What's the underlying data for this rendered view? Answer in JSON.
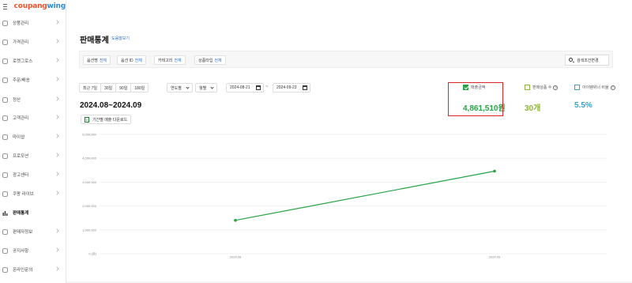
{
  "app": {
    "logo_parts": [
      "coupang",
      " ",
      "wing"
    ],
    "colors": {
      "accent": "#2a6fd0",
      "green": "#27a346",
      "olive": "#8cb43c",
      "teal": "#3aa0c8",
      "highlight": "#d8262c"
    }
  },
  "sidebar": {
    "items": [
      {
        "label": "상품관리",
        "icon": "box-icon"
      },
      {
        "label": "가격관리",
        "icon": "price-tag-icon"
      },
      {
        "label": "로켓그로스",
        "icon": "rocket-icon"
      },
      {
        "label": "주문/배송",
        "icon": "truck-icon"
      },
      {
        "label": "정산",
        "icon": "coin-icon"
      },
      {
        "label": "고객관리",
        "icon": "smile-icon"
      },
      {
        "label": "마이샵",
        "icon": "shop-icon"
      },
      {
        "label": "프로모션",
        "icon": "promotion-icon"
      },
      {
        "label": "광고센터",
        "icon": "ad-icon"
      },
      {
        "label": "쿠팡 라이브",
        "icon": "live-icon"
      },
      {
        "label": "판매통계",
        "icon": "bar-chart-icon",
        "active": true
      },
      {
        "label": "판매자정보",
        "icon": "user-icon"
      },
      {
        "label": "공지사항",
        "icon": "notice-icon"
      },
      {
        "label": "온라인문의",
        "icon": "headset-icon"
      }
    ]
  },
  "page": {
    "title": "판매통계",
    "help_link": "도움말보기"
  },
  "filters": {
    "chips": [
      {
        "label": "옵션명",
        "value": "전체"
      },
      {
        "label": "옵션 ID",
        "value": "전체"
      },
      {
        "label": "카테고리",
        "value": "전체"
      },
      {
        "label": "상품타입",
        "value": "전체"
      }
    ],
    "search_button": "검색조건변경"
  },
  "range": {
    "presets": [
      "최근 7일",
      "30일",
      "90일",
      "180일"
    ],
    "unit_select": "연도별",
    "month_select": "월별",
    "start_date": "2024-08-21",
    "end_date": "2024-09-23",
    "separator": "~"
  },
  "period_label": "2024.08~2024.09",
  "download_button": "기간별 매출 다운로드",
  "metrics": [
    {
      "label": "매출금액",
      "value": "4,861,510원",
      "checked": true,
      "color": "#27a346"
    },
    {
      "label": "판매상품 수",
      "value": "30개",
      "checked": false,
      "color": "#8cb43c"
    },
    {
      "label": "아이템위너 비율",
      "value": "5.5%",
      "checked": false,
      "color": "#3aa0c8"
    }
  ],
  "chart_data": {
    "type": "line",
    "title": "",
    "xlabel": "",
    "ylabel": "",
    "categories": [
      "2024.08",
      "2024.09"
    ],
    "series": [
      {
        "values": [
          1400000,
          3460000
        ],
        "color": "#27a346"
      }
    ],
    "yticks": [
      "0 (원)",
      "1,000,000",
      "2,000,000",
      "3,000,000",
      "4,000,000",
      "5,000,000"
    ],
    "ylim": [
      0,
      5000000
    ],
    "grid": true
  }
}
